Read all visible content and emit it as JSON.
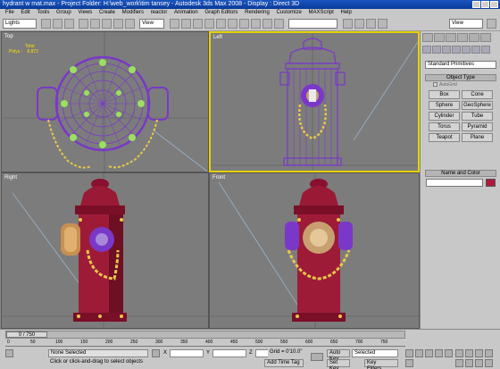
{
  "window": {
    "title": "hydrant w mat.max    - Project Folder: H:\\web_work\\tim tansey      - Autodesk 3ds Max 2008      - Display : Direct 3D"
  },
  "menu": [
    "File",
    "Edit",
    "Tools",
    "Group",
    "Views",
    "Create",
    "Modifiers",
    "reactor",
    "Animation",
    "Graph Editors",
    "Rendering",
    "Customize",
    "MAXScript",
    "Help"
  ],
  "toolbar": {
    "selection_filter": "Lights",
    "ref_coord": "View",
    "named_sel": "View"
  },
  "viewports": {
    "top": {
      "label": "Top",
      "stats_total_label": "Total",
      "stats_polys_label": "Polys :",
      "stats_polys_value": "8,872"
    },
    "left": {
      "label": "Left"
    },
    "right": {
      "label": "Right"
    },
    "front": {
      "label": "Front"
    }
  },
  "command_panel": {
    "category": "Standard Primitives",
    "object_type_header": "Object Type",
    "autogrid_label": "AutoGrid",
    "buttons": [
      "Box",
      "Cone",
      "Sphere",
      "GeoSphere",
      "Cylinder",
      "Tube",
      "Torus",
      "Pyramid",
      "Teapot",
      "Plane"
    ],
    "name_color_header": "Name and Color",
    "swatch_color": "#ad1a3a"
  },
  "timeline": {
    "frame_counter": "0 / 750",
    "ticks": [
      "0",
      "50",
      "100",
      "150",
      "200",
      "250",
      "300",
      "350",
      "400",
      "450",
      "500",
      "550",
      "600",
      "650",
      "700",
      "750"
    ]
  },
  "status": {
    "selection": "None Selected",
    "prompt": "Click or click-and-drag to select objects",
    "x_label": "X",
    "y_label": "Y",
    "z_label": "Z",
    "grid": "Grid = 0'10.0\"",
    "add_time_tag": "Add Time Tag",
    "auto_key": "Auto Key",
    "set_key": "Set Key",
    "key_mode": "Selected",
    "key_filters": "Key Filters..."
  }
}
